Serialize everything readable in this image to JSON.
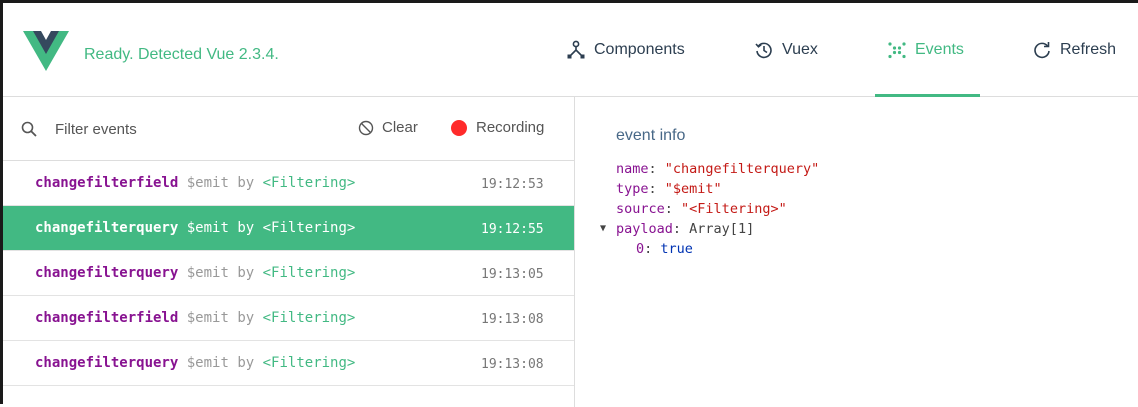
{
  "header": {
    "status_text": "Ready. Detected Vue 2.3.4.",
    "colors": {
      "accent": "#42b983",
      "logo_dark": "#35495e"
    },
    "tabs": [
      {
        "label": "Components",
        "icon": "components-icon",
        "active": false
      },
      {
        "label": "Vuex",
        "icon": "history-icon",
        "active": false
      },
      {
        "label": "Events",
        "icon": "events-icon",
        "active": true
      },
      {
        "label": "Refresh",
        "icon": "refresh-icon",
        "active": false
      }
    ]
  },
  "events_panel": {
    "filter_placeholder": "Filter events",
    "clear_label": "Clear",
    "recording_label": "Recording",
    "events": [
      {
        "name": "changefilterfield",
        "type": "$emit",
        "by": "by",
        "component": "<Filtering>",
        "time": "19:12:53",
        "selected": false
      },
      {
        "name": "changefilterquery",
        "type": "$emit",
        "by": "by",
        "component": "<Filtering>",
        "time": "19:12:55",
        "selected": true
      },
      {
        "name": "changefilterquery",
        "type": "$emit",
        "by": "by",
        "component": "<Filtering>",
        "time": "19:13:05",
        "selected": false
      },
      {
        "name": "changefilterfield",
        "type": "$emit",
        "by": "by",
        "component": "<Filtering>",
        "time": "19:13:08",
        "selected": false
      },
      {
        "name": "changefilterquery",
        "type": "$emit",
        "by": "by",
        "component": "<Filtering>",
        "time": "19:13:08",
        "selected": false
      }
    ]
  },
  "event_info": {
    "title": "event info",
    "name_key": "name",
    "name_value": "\"changefilterquery\"",
    "type_key": "type",
    "type_value": "\"$emit\"",
    "source_key": "source",
    "source_value": "\"<Filtering>\"",
    "payload_key": "payload",
    "payload_value": "Array[1]",
    "payload_item_key": "0",
    "payload_item_value": "true"
  }
}
